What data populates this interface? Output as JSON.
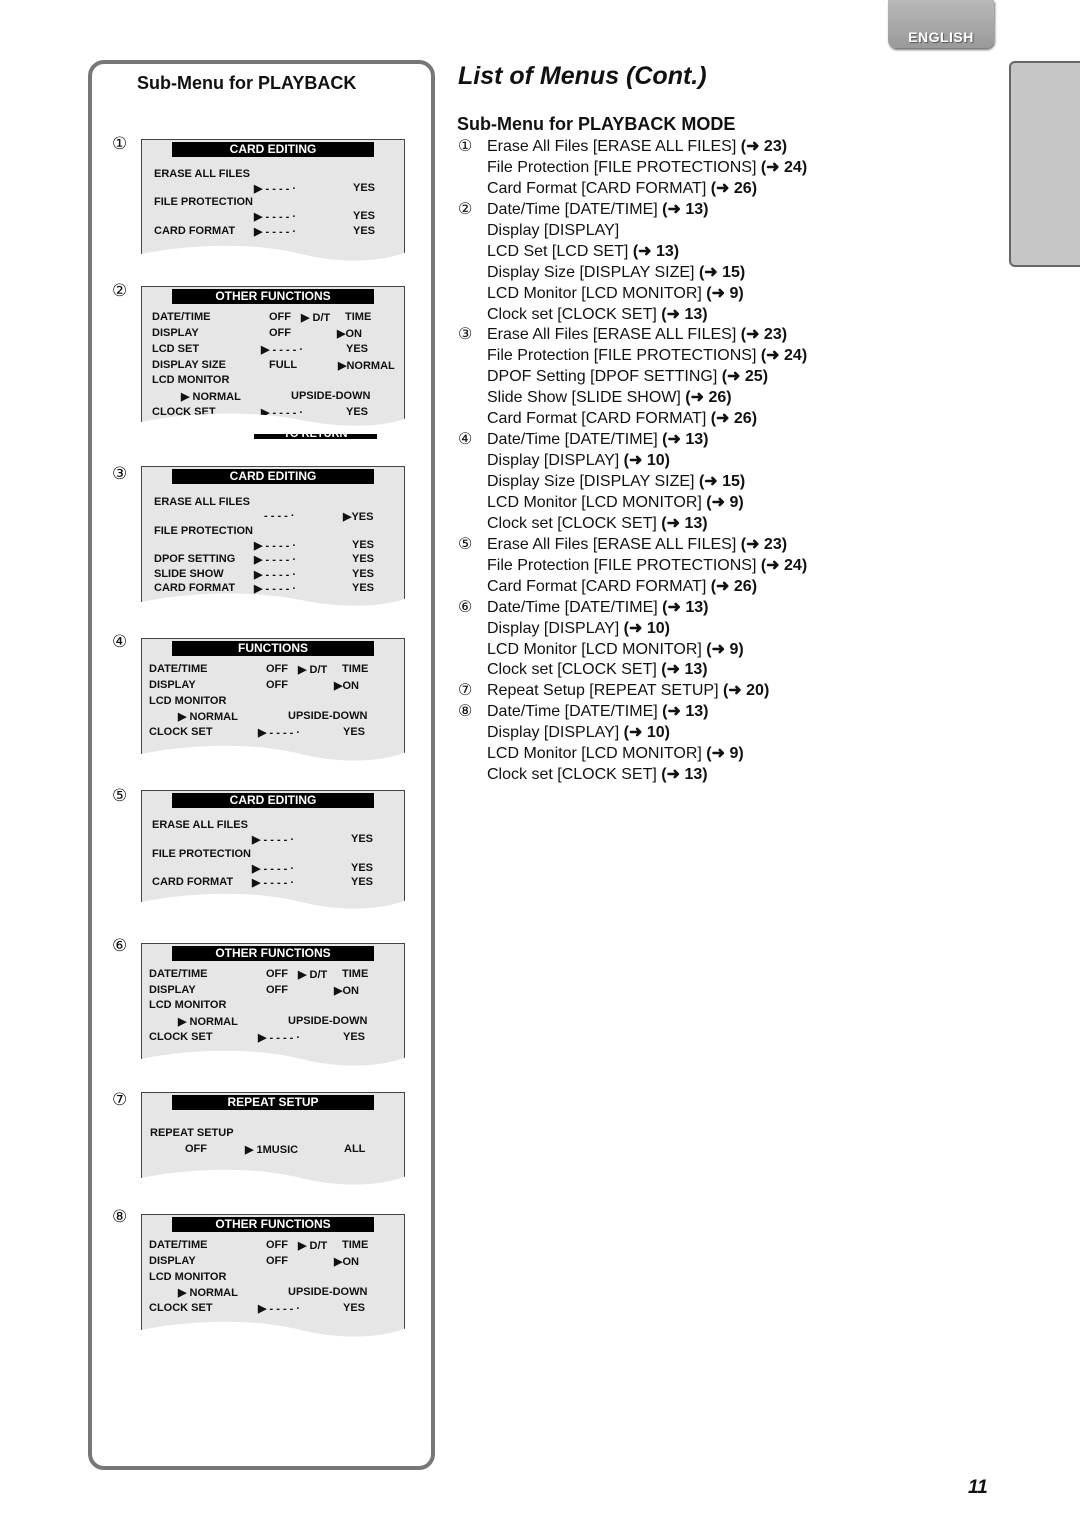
{
  "language_tab": "ENGLISH",
  "page_number": "11",
  "left": {
    "title": "Sub-Menu for PLAYBACK",
    "panels": [
      {
        "num": "①",
        "header": "CARD EDITING"
      },
      {
        "num": "②",
        "header": "OTHER FUNCTIONS",
        "footer": "TO RETURN"
      },
      {
        "num": "③",
        "header": "CARD EDITING"
      },
      {
        "num": "④",
        "header": "FUNCTIONS"
      },
      {
        "num": "⑤",
        "header": "CARD EDITING"
      },
      {
        "num": "⑥",
        "header": "OTHER FUNCTIONS"
      },
      {
        "num": "⑦",
        "header": "REPEAT SETUP"
      },
      {
        "num": "⑧",
        "header": "OTHER FUNCTIONS"
      }
    ],
    "labels": {
      "erase_all_files": "ERASE  ALL  FILES",
      "file_protection": "FILE  PROTECTION",
      "card_format": "CARD  FORMAT",
      "dpof_setting": "DPOF  SETTING",
      "slide_show": "SLIDE  SHOW",
      "date_time": "DATE/TIME",
      "display": "DISPLAY",
      "lcd_set": "LCD SET",
      "display_size": "DISPLAY SIZE",
      "lcd_monitor": "LCD MONITOR",
      "clock_set": "CLOCK SET",
      "repeat_setup": "REPEAT  SETUP",
      "dashes": "▶ - - - - ·",
      "dashes_plain": "- - - - ·",
      "yes": "YES",
      "yes_sel": "▶YES",
      "off": "OFF",
      "dt_sel": "▶ D/T",
      "time": "TIME",
      "on_sel": "▶ON",
      "full": "FULL",
      "normal_sel": "▶NORMAL",
      "normal_sel2": "▶ NORMAL",
      "upside_down": "UPSIDE-DOWN",
      "one_music_sel": "▶ 1MUSIC",
      "all": "ALL"
    }
  },
  "right": {
    "title": "List of Menus (Cont.)",
    "subtitle": "Sub-Menu for PLAYBACK MODE",
    "items": [
      {
        "n": "①",
        "text": "Erase All Files [ERASE ALL FILES] ",
        "ref": "(➜ 23)"
      },
      {
        "n": "",
        "text": "File Protection [FILE PROTECTIONS] ",
        "ref": "(➜ 24)"
      },
      {
        "n": "",
        "text": "Card Format [CARD FORMAT] ",
        "ref": "(➜ 26)"
      },
      {
        "n": "②",
        "text": "Date/Time [DATE/TIME] ",
        "ref": "(➜ 13)"
      },
      {
        "n": "",
        "text": "Display [DISPLAY]",
        "ref": ""
      },
      {
        "n": "",
        "text": "LCD Set [LCD SET] ",
        "ref": "(➜ 13)"
      },
      {
        "n": "",
        "text": "Display Size [DISPLAY SIZE] ",
        "ref": "(➜ 15)"
      },
      {
        "n": "",
        "text": "LCD Monitor [LCD MONITOR] ",
        "ref": "(➜ 9)"
      },
      {
        "n": "",
        "text": "Clock set [CLOCK SET] ",
        "ref": "(➜ 13)"
      },
      {
        "n": "③",
        "text": "Erase All Files [ERASE ALL FILES] ",
        "ref": "(➜ 23)"
      },
      {
        "n": "",
        "text": "File Protection [FILE PROTECTIONS] ",
        "ref": "(➜ 24)"
      },
      {
        "n": "",
        "text": "DPOF Setting [DPOF SETTING] ",
        "ref": "(➜ 25)"
      },
      {
        "n": "",
        "text": "Slide Show [SLIDE SHOW] ",
        "ref": "(➜ 26)"
      },
      {
        "n": "",
        "text": "Card Format [CARD FORMAT] ",
        "ref": "(➜ 26)"
      },
      {
        "n": "④",
        "text": "Date/Time [DATE/TIME] ",
        "ref": "(➜ 13)"
      },
      {
        "n": "",
        "text": "Display [DISPLAY] ",
        "ref": "(➜ 10)"
      },
      {
        "n": "",
        "text": "Display Size [DISPLAY SIZE] ",
        "ref": "(➜ 15)"
      },
      {
        "n": "",
        "text": "LCD Monitor [LCD MONITOR] ",
        "ref": "(➜ 9)"
      },
      {
        "n": "",
        "text": "Clock set [CLOCK SET] ",
        "ref": "(➜ 13)"
      },
      {
        "n": "⑤",
        "text": "Erase All Files [ERASE ALL FILES] ",
        "ref": "(➜ 23)"
      },
      {
        "n": "",
        "text": "File Protection [FILE PROTECTIONS] ",
        "ref": "(➜ 24)"
      },
      {
        "n": "",
        "text": "Card Format [CARD FORMAT] ",
        "ref": "(➜ 26)"
      },
      {
        "n": "⑥",
        "text": "Date/Time [DATE/TIME] ",
        "ref": "(➜ 13)"
      },
      {
        "n": "",
        "text": "Display [DISPLAY] ",
        "ref": "(➜ 10)"
      },
      {
        "n": "",
        "text": "LCD Monitor [LCD MONITOR] ",
        "ref": "(➜ 9)"
      },
      {
        "n": "",
        "text": "Clock set [CLOCK SET] ",
        "ref": "(➜ 13)"
      },
      {
        "n": "⑦",
        "text": "Repeat Setup [REPEAT SETUP] ",
        "ref": "(➜ 20)"
      },
      {
        "n": "⑧",
        "text": "Date/Time [DATE/TIME] ",
        "ref": "(➜ 13)"
      },
      {
        "n": "",
        "text": "Display [DISPLAY] ",
        "ref": "(➜ 10)"
      },
      {
        "n": "",
        "text": "LCD Monitor [LCD MONITOR] ",
        "ref": "(➜ 9)"
      },
      {
        "n": "",
        "text": "Clock set [CLOCK SET] ",
        "ref": "(➜ 13)"
      }
    ]
  }
}
